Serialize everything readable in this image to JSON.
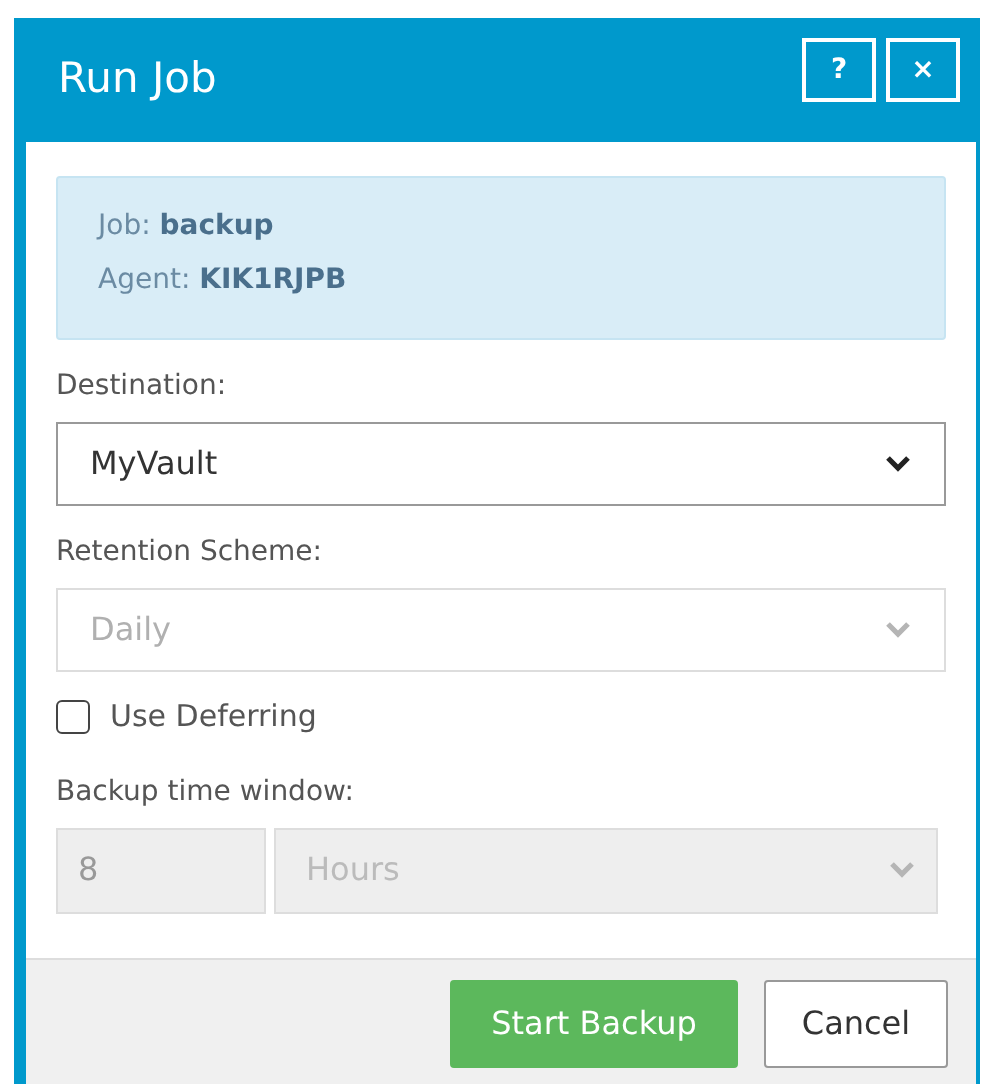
{
  "window": {
    "title": "Run Job",
    "buttons": [
      {
        "label": "?"
      },
      {
        "label": "×"
      }
    ]
  },
  "info": [
    {
      "label": "Job:",
      "value": "backup"
    },
    {
      "label": "Agent:",
      "value": "KIK1RJPB"
    }
  ],
  "destination": {
    "label": "Destination:",
    "value": "MyVault",
    "disabled": false
  },
  "retention": {
    "label": "Retention Scheme:",
    "value": "Daily",
    "disabled": true
  },
  "deferring": {
    "label": "Use Deferring",
    "checked": false
  },
  "time_window": {
    "label": "Backup time window:",
    "amount": "8",
    "unit": "Hours",
    "disabled": true
  },
  "buttons": [
    {
      "kind": "primary",
      "label": "Start Backup"
    },
    {
      "kind": "default",
      "label": "Cancel"
    }
  ]
}
